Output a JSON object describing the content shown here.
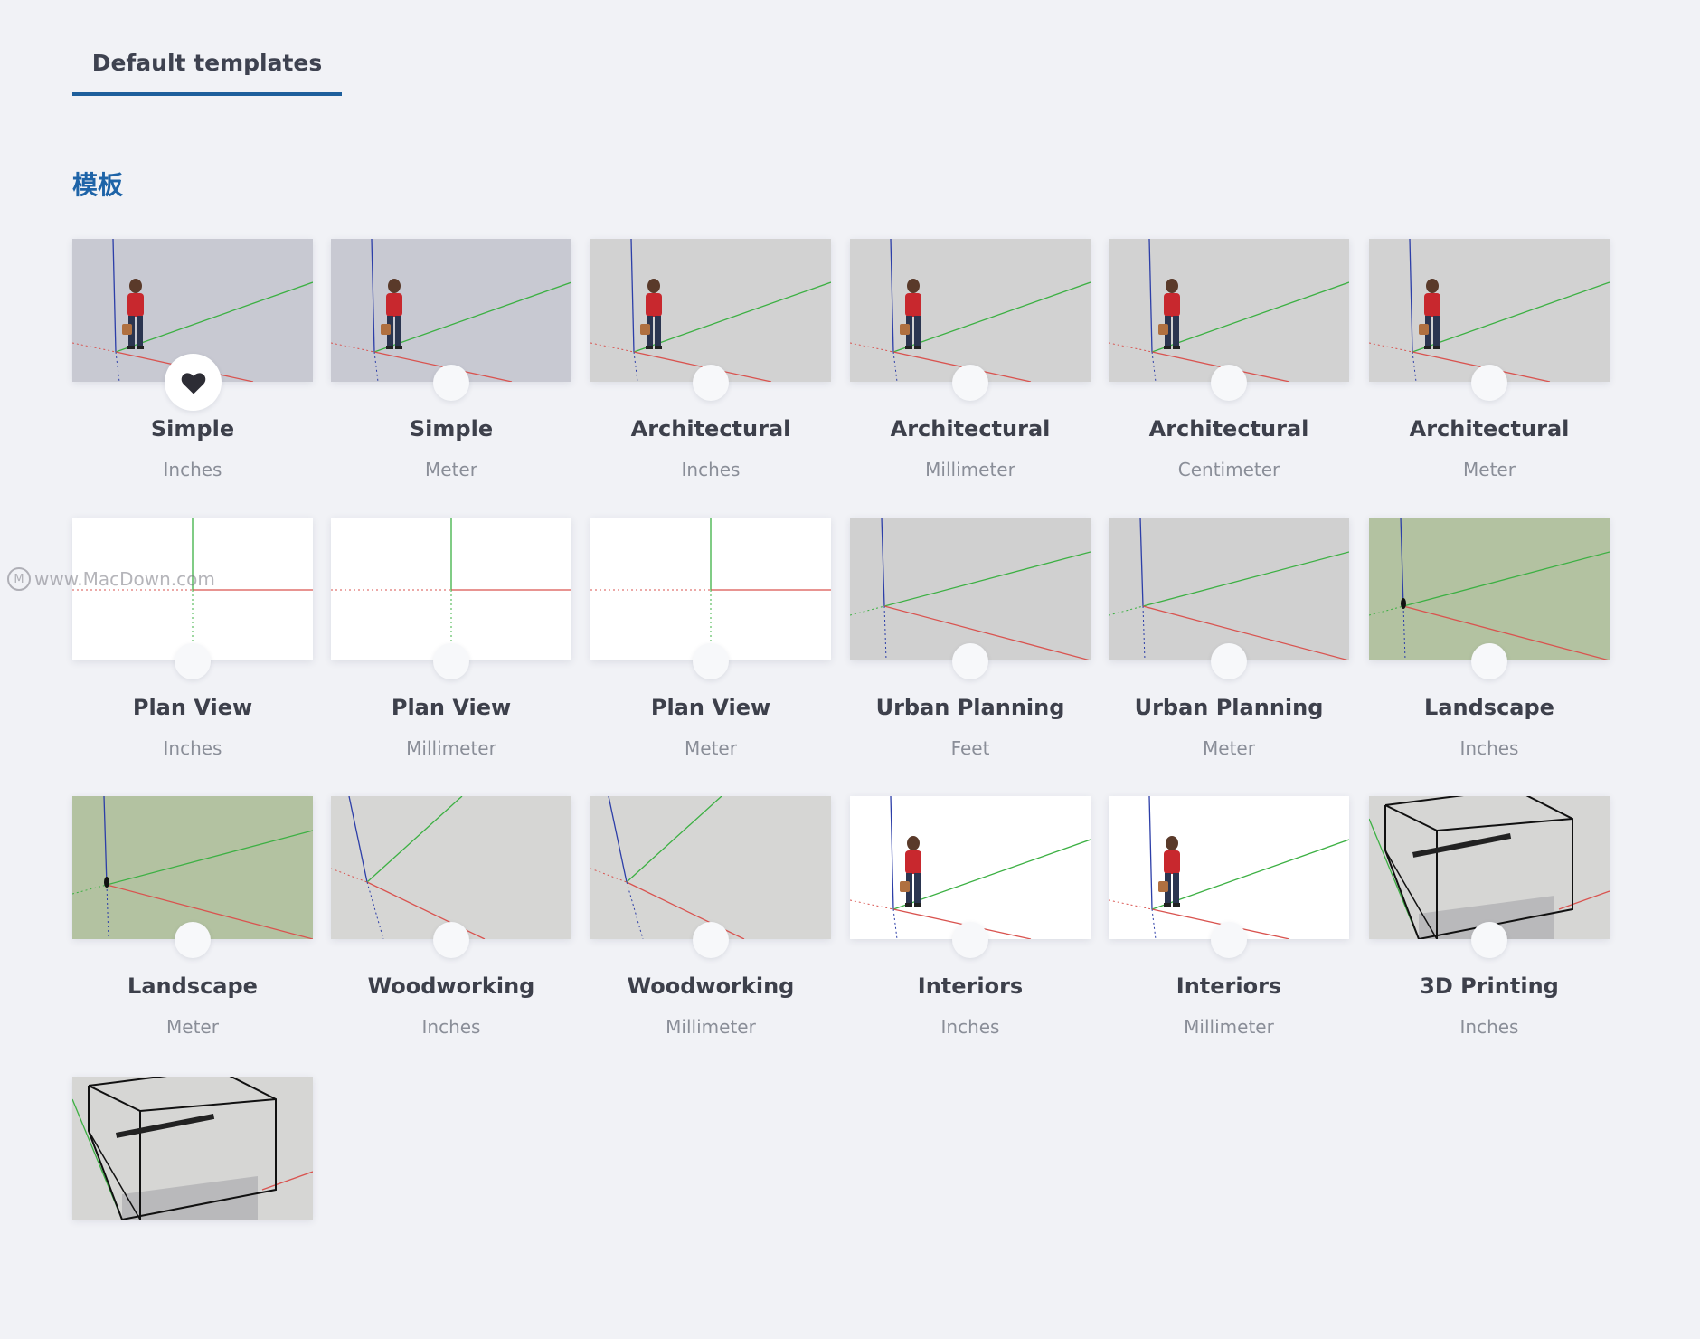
{
  "tabs": [
    {
      "label": "Default templates",
      "active": true
    }
  ],
  "section_title": "模板",
  "watermark": {
    "text": "www.MacDown.com",
    "logo": "M"
  },
  "templates": [
    {
      "name": "Simple",
      "unit": "Inches",
      "thumb": "figure-gray",
      "favorite": true
    },
    {
      "name": "Simple",
      "unit": "Meter",
      "thumb": "figure-gray",
      "favorite": false
    },
    {
      "name": "Architectural",
      "unit": "Inches",
      "thumb": "figure-light",
      "favorite": false
    },
    {
      "name": "Architectural",
      "unit": "Millimeter",
      "thumb": "figure-light",
      "favorite": false
    },
    {
      "name": "Architectural",
      "unit": "Centimeter",
      "thumb": "figure-light",
      "favorite": false
    },
    {
      "name": "Architectural",
      "unit": "Meter",
      "thumb": "figure-light",
      "favorite": false
    },
    {
      "name": "Plan View",
      "unit": "Inches",
      "thumb": "plan",
      "favorite": false
    },
    {
      "name": "Plan View",
      "unit": "Millimeter",
      "thumb": "plan",
      "favorite": false
    },
    {
      "name": "Plan View",
      "unit": "Meter",
      "thumb": "plan",
      "favorite": false
    },
    {
      "name": "Urban Planning",
      "unit": "Feet",
      "thumb": "axes-gray",
      "favorite": false
    },
    {
      "name": "Urban Planning",
      "unit": "Meter",
      "thumb": "axes-gray",
      "favorite": false
    },
    {
      "name": "Landscape",
      "unit": "Inches",
      "thumb": "axes-green",
      "favorite": false
    },
    {
      "name": "Landscape",
      "unit": "Meter",
      "thumb": "axes-green",
      "favorite": false
    },
    {
      "name": "Woodworking",
      "unit": "Inches",
      "thumb": "wood",
      "favorite": false
    },
    {
      "name": "Woodworking",
      "unit": "Millimeter",
      "thumb": "wood",
      "favorite": false
    },
    {
      "name": "Interiors",
      "unit": "Inches",
      "thumb": "figure-white",
      "favorite": false
    },
    {
      "name": "Interiors",
      "unit": "Millimeter",
      "thumb": "figure-white",
      "favorite": false
    },
    {
      "name": "3D Printing",
      "unit": "Inches",
      "thumb": "printer",
      "favorite": false
    },
    {
      "name": "",
      "unit": "",
      "thumb": "printer",
      "favorite": false
    }
  ],
  "colors": {
    "accent": "#1e5f9c",
    "section": "#1e64a8",
    "axis_red": "#d9534f",
    "axis_green": "#3cb043",
    "axis_blue": "#2c3ea8"
  }
}
